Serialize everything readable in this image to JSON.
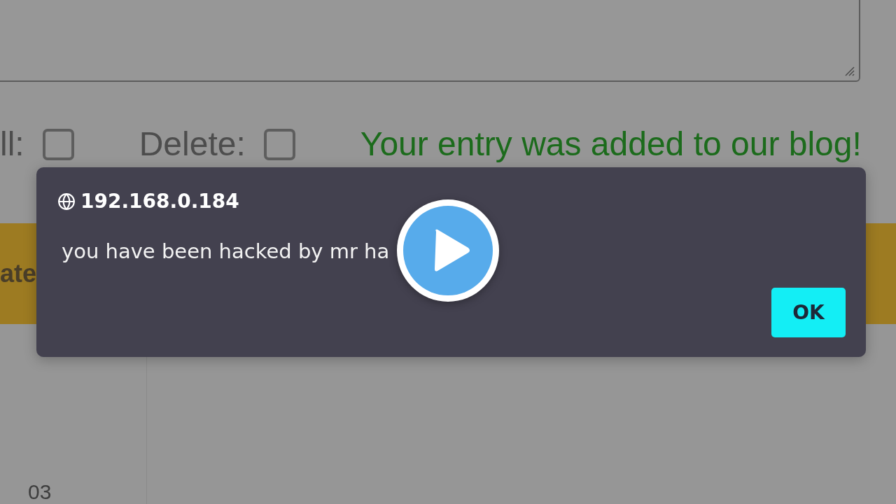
{
  "page": {
    "options": [
      {
        "label": "ll:",
        "checked": false
      },
      {
        "label": "Delete:",
        "checked": false
      }
    ],
    "status_message": "Your entry was added to our blog!",
    "banner": {
      "text": "ate"
    },
    "table": {
      "cell": "03"
    }
  },
  "alert": {
    "origin": "192.168.0.184",
    "message": "you have been hacked by mr ha",
    "buttons": [
      "OK"
    ]
  }
}
